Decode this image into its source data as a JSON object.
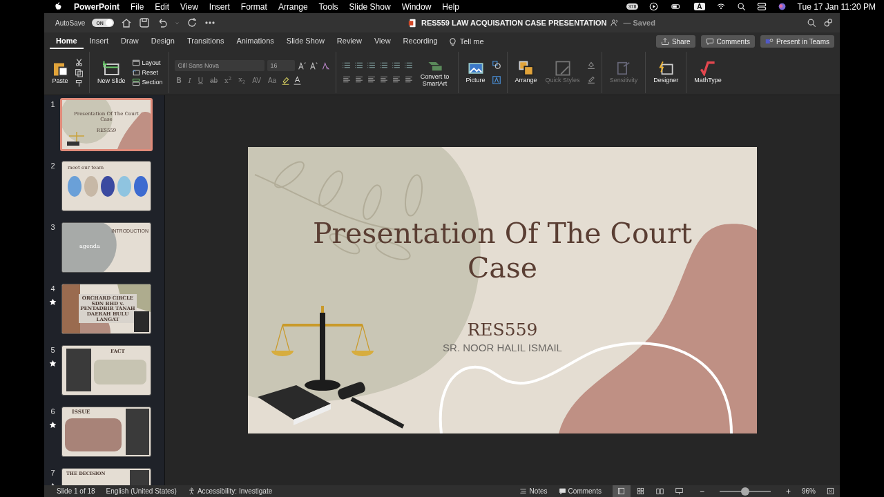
{
  "menubar": {
    "app": "PowerPoint",
    "menus": [
      "File",
      "Edit",
      "View",
      "Insert",
      "Format",
      "Arrange",
      "Tools",
      "Slide Show",
      "Window",
      "Help"
    ],
    "badge": "378",
    "input_source": "A",
    "datetime": "Tue 17 Jan  11:20 PM"
  },
  "titlebar": {
    "autosave_label": "AutoSave",
    "autosave_toggle": {
      "label": "ON",
      "on": true
    },
    "title": "RES559 LAW ACQUISATION CASE PRESENTATION",
    "save_state": "— Saved"
  },
  "tabs": [
    {
      "label": "Home",
      "selected": true
    },
    {
      "label": "Insert",
      "selected": false
    },
    {
      "label": "Draw",
      "selected": false
    },
    {
      "label": "Design",
      "selected": false
    },
    {
      "label": "Transitions",
      "selected": false
    },
    {
      "label": "Animations",
      "selected": false
    },
    {
      "label": "Slide Show",
      "selected": false
    },
    {
      "label": "Review",
      "selected": false
    },
    {
      "label": "View",
      "selected": false
    },
    {
      "label": "Recording",
      "selected": false
    }
  ],
  "tell_me": "Tell me",
  "actions": [
    "Share",
    "Comments",
    "Present in Teams"
  ],
  "ribbon": {
    "paste": "Paste",
    "new_slide": "New Slide",
    "slide_commands": [
      "Layout",
      "Reset",
      "Section"
    ],
    "font": {
      "value": "Gill Sans Nova"
    },
    "font_size": {
      "value": "16"
    },
    "format_buttons": [
      {
        "label": "B",
        "kind": "bold"
      },
      {
        "label": "I",
        "kind": "italic"
      },
      {
        "label": "U",
        "kind": "underline"
      },
      {
        "label": "ab",
        "kind": "strike"
      },
      {
        "label": "x",
        "kind": "super",
        "index": "2"
      },
      {
        "label": "x",
        "kind": "sub",
        "index": "2"
      },
      {
        "label": "AV",
        "kind": "plain"
      },
      {
        "label": "Aa",
        "kind": "plain"
      }
    ],
    "convert": "Convert to SmartArt",
    "picture": "Picture",
    "arrange": "Arrange",
    "quick_styles": "Quick Styles",
    "sensitivity": {
      "label": "Sensitivity",
      "disabled": true
    },
    "designer": "Designer",
    "mathtype": "MathType"
  },
  "thumbnails": [
    {
      "number": "1",
      "selected": true,
      "animated": false,
      "kind": "title",
      "title": "Presentation Of The Court Case",
      "subtitle": "RES559"
    },
    {
      "number": "2",
      "selected": false,
      "animated": false,
      "kind": "team",
      "title": "meet our team"
    },
    {
      "number": "3",
      "selected": false,
      "animated": false,
      "kind": "agenda",
      "title": "agenda",
      "subtitle": "INTRODUCTION"
    },
    {
      "number": "4",
      "selected": false,
      "animated": true,
      "kind": "case",
      "title": "ORCHARD CIRCLE SDN BHD v. PENTADBIR TANAH DAERAH HULU LANGAT"
    },
    {
      "number": "5",
      "selected": false,
      "animated": true,
      "kind": "fact",
      "title": "FACT"
    },
    {
      "number": "6",
      "selected": false,
      "animated": true,
      "kind": "issue",
      "title": "ISSUE"
    },
    {
      "number": "7",
      "selected": false,
      "animated": true,
      "kind": "decision",
      "title": "THE DECISION"
    }
  ],
  "slide": {
    "title": "Presentation Of The Court Case",
    "code": "RES559",
    "presenter": "SR. NOOR HALIL ISMAIL"
  },
  "status_bar": {
    "slide": "Slide 1 of 18",
    "language": "English (United States)",
    "accessibility": "Accessibility: Investigate",
    "notes": "Notes",
    "comments": "Comments",
    "views": [
      {
        "selected": true
      },
      {
        "selected": false
      },
      {
        "selected": false
      },
      {
        "selected": false
      }
    ],
    "zoom_out": "−",
    "zoom_in": "+",
    "zoom": {
      "level": 0.5,
      "reading": "96%"
    }
  }
}
